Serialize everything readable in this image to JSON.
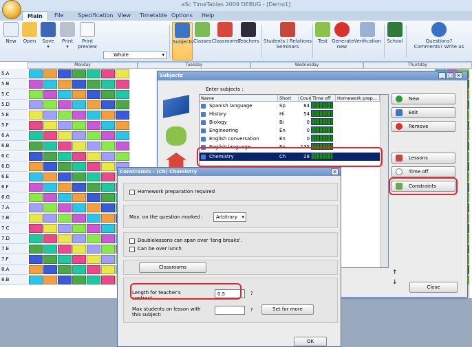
{
  "title": "aSc TimeTables 2009  DEBUG - [Demo1]",
  "tabs": [
    "Main",
    "File",
    "Specification",
    "View",
    "Timetable",
    "Options",
    "Help"
  ],
  "ribbon": {
    "buttons": [
      {
        "label": "New",
        "sub": ""
      },
      {
        "label": "Open",
        "sub": ""
      },
      {
        "label": "Save",
        "sub": "▾"
      },
      {
        "label": "Print",
        "sub": "▾"
      },
      {
        "label": "Print",
        "sub": "preview"
      },
      {
        "label": "Subjects",
        "sub": ""
      },
      {
        "label": "Classes",
        "sub": ""
      },
      {
        "label": "Classrooms",
        "sub": ""
      },
      {
        "label": "Teachers",
        "sub": ""
      },
      {
        "label": "Students / Relations",
        "sub": "Seminars"
      },
      {
        "label": "Test",
        "sub": ""
      },
      {
        "label": "Generate",
        "sub": "new"
      },
      {
        "label": "Verification",
        "sub": ""
      },
      {
        "label": "School",
        "sub": ""
      },
      {
        "label": "Questions?",
        "sub": "Comments? Write us"
      }
    ],
    "view_select": "Whole"
  },
  "days": [
    "Monday",
    "Tuesday",
    "Wednesday",
    "Thursday"
  ],
  "classes": [
    "5.A",
    "5.B",
    "5.C",
    "5.D",
    "5.E",
    "5.F",
    "6.A",
    "6.B",
    "6.C",
    "6.D",
    "6.E",
    "6.F",
    "6.G",
    "7.A",
    "7.B",
    "7.C",
    "7.D",
    "7.E",
    "7.F",
    "8.A",
    "8.B"
  ],
  "subjects_window": {
    "title": "Subjects",
    "enter_label": "Enter subjects :",
    "columns": [
      "Name",
      "Short",
      "Count",
      "Time off",
      "Homework prep..."
    ],
    "rows": [
      {
        "name": "Spanish language",
        "short": "Sp",
        "count": "84"
      },
      {
        "name": "History",
        "short": "Hi",
        "count": "54"
      },
      {
        "name": "Biology",
        "short": "Bi",
        "count": "0"
      },
      {
        "name": "Engineering",
        "short": "En",
        "count": "0"
      },
      {
        "name": "English conversation",
        "short": "En",
        "count": "0"
      },
      {
        "name": "English language",
        "short": "En",
        "count": "135"
      },
      {
        "name": "Chemistry",
        "short": "Ch",
        "count": "28"
      }
    ],
    "buttons": [
      "New",
      "Edit",
      "Remove",
      "Lessons",
      "Time off",
      "Constraints",
      "Close"
    ]
  },
  "constraints": {
    "title": "Constraints - (Ch) Chemistry",
    "homework": "Homework preparation required",
    "max_marked_label": "Max. on the question marked :",
    "max_marked_value": "Arbitrary",
    "double_break": "Doublelessons can span over 'long breaks'.",
    "over_lunch": "Can be over lunch",
    "classrooms": "Classrooms",
    "length_label": "Length for teacher's contract:",
    "length_value": "0.5",
    "q": "?",
    "max_students_label": "Max students on lesson with this subject:",
    "set_for_more": "Set for more",
    "ok": "OK"
  },
  "colors": {
    "accent": "#e0262e",
    "selected": "#0a246a"
  }
}
